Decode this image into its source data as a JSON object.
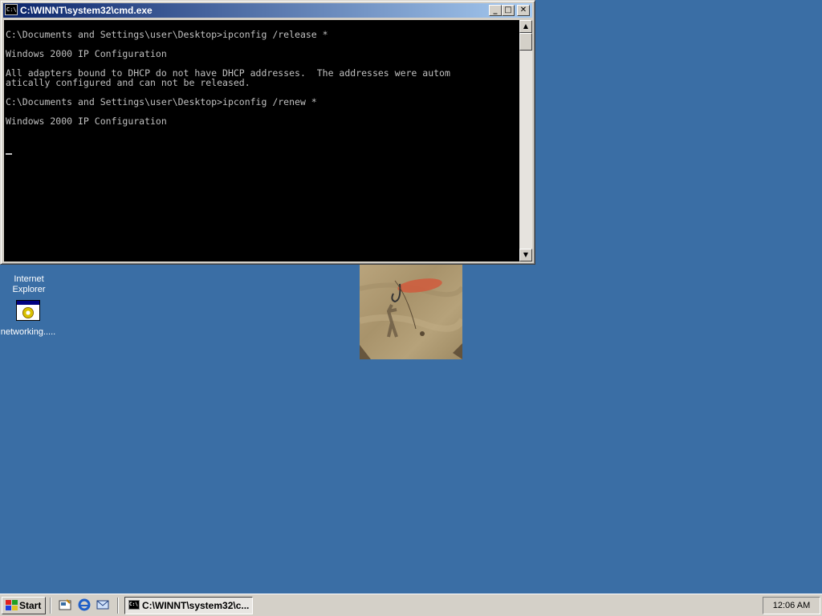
{
  "window": {
    "title": "C:\\WINNT\\system32\\cmd.exe",
    "app_icon_text": "C:\\",
    "minimize_glyph": "_",
    "maximize_glyph": "□",
    "close_glyph": "✕"
  },
  "console": {
    "lines": [
      "C:\\Documents and Settings\\user\\Desktop>ipconfig /release *",
      "",
      "Windows 2000 IP Configuration",
      "",
      "All adapters bound to DHCP do not have DHCP addresses.  The addresses were autom",
      "atically configured and can not be released.",
      "",
      "C:\\Documents and Settings\\user\\Desktop>ipconfig /renew *",
      "",
      "Windows 2000 IP Configuration",
      "",
      ""
    ]
  },
  "desktop": {
    "icons": [
      {
        "label": "Internet\nExplorer",
        "icon": "internet-explorer-icon"
      },
      {
        "label": "networking.....",
        "icon": "networking-app-icon"
      }
    ]
  },
  "taskbar": {
    "start_label": "Start",
    "task_label": "C:\\WINNT\\system32\\c...",
    "clock": "12:06 AM",
    "quick_launch": [
      "show-desktop-icon",
      "internet-explorer-icon",
      "outlook-express-icon"
    ]
  },
  "colors": {
    "desktop": "#3a6ea5",
    "titlebar_start": "#0a246a",
    "titlebar_end": "#a6caf0",
    "console_bg": "#000000",
    "console_fg": "#c0c0c0"
  }
}
